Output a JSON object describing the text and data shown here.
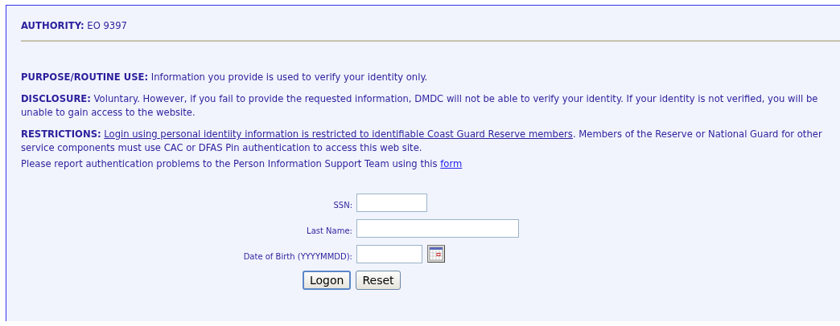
{
  "authority": {
    "label": "AUTHORITY:",
    "text": "EO 9397"
  },
  "notices": [
    {
      "label": "PURPOSE/ROUTINE USE:",
      "text": "Information you provide is used to verify your identity only."
    },
    {
      "label": "DISCLOSURE:",
      "text": "Voluntary. However, if you fail to provide the requested information, DMDC will not be able to verify your identity. If your identity is not verified, you will be unable to gain access to the website."
    },
    {
      "label": "RESTRICTIONS:",
      "link": "Login using personal identiity information is restricted to identifiable Coast Guard Reserve members",
      "text": ". Members of the Reserve or National Guard for other service components must use CAC or DFAS Pin authentication to access this web site."
    }
  ],
  "report": {
    "text": "Please report authentication problems to the Person Information Support Team using this",
    "link": "form"
  },
  "form": {
    "fields": [
      {
        "label": "SSN:",
        "kind": "short"
      },
      {
        "label": "Last Name:",
        "kind": "long"
      },
      {
        "label": "Date of Birth (YYYYMMDD):",
        "kind": "date"
      }
    ],
    "buttons": [
      {
        "label": "Logon",
        "default": true
      },
      {
        "label": "Reset",
        "default": false
      }
    ]
  }
}
